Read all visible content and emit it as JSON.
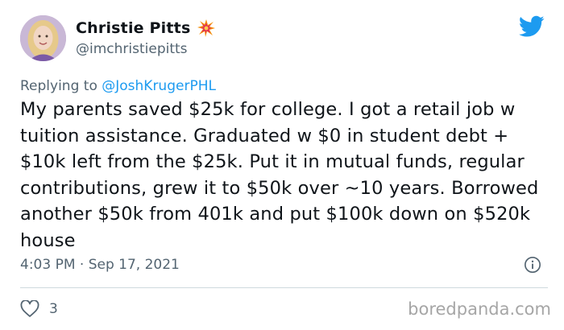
{
  "author": {
    "name": "Christie Pitts",
    "handle": "@imchristiepitts",
    "badge_icon": "boom-icon"
  },
  "reply": {
    "prefix": "Replying to ",
    "mention": "@JoshKrugerPHL"
  },
  "tweet_text": "My parents saved $25k for college. I got a retail job w tuition assistance. Graduated w $0 in student debt + $10k left from the $25k. Put it in mutual funds, regular contributions, grew it to $50k over ~10 years. Borrowed another $50k from 401k and put $100k down on $520k house",
  "timestamp": "4:03 PM · Sep 17, 2021",
  "likes": "3",
  "watermark": "boredpanda.com",
  "colors": {
    "accent": "#1d9bf0",
    "secondary_text": "#536471",
    "divider": "#cfd9de"
  },
  "icons": [
    "twitter-bird-icon",
    "info-icon",
    "heart-icon"
  ]
}
